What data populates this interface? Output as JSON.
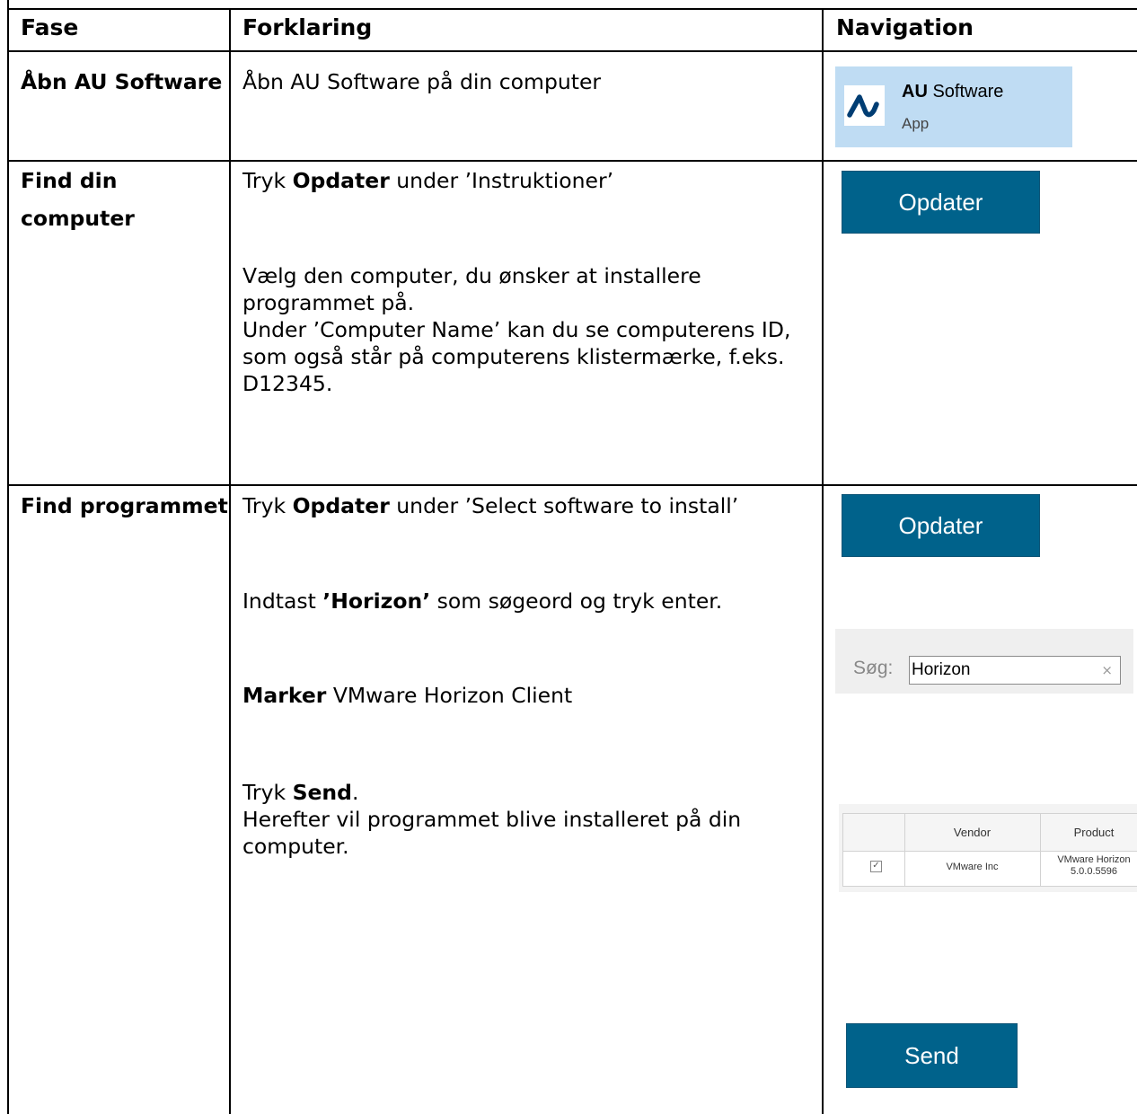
{
  "table": {
    "headers": {
      "phase": "Fase",
      "explanation": "Forklaring",
      "navigation": "Navigation"
    },
    "rows": [
      {
        "phase": "Åbn AU Software",
        "explanation": "Åbn AU Software på din computer"
      },
      {
        "phase_line1": "Find din",
        "phase_line2": "computer",
        "step1_prefix": "Tryk ",
        "step1_bold": "Opdater",
        "step1_suffix": " under ’Instruktioner’",
        "step2_line1": "Vælg den computer, du ønsker at installere",
        "step2_line2": "programmet på.",
        "step2_line3": "Under ’Computer Name’ kan du se computerens ID,",
        "step2_line4": "som også står på computerens klistermærke, f.eks.",
        "step2_line5": "D12345."
      },
      {
        "phase": "Find programmet",
        "step1_prefix": "Tryk ",
        "step1_bold": "Opdater",
        "step1_suffix": " under ’Select software to install’",
        "step2_prefix": "Indtast ",
        "step2_bold": "’Horizon’",
        "step2_suffix": " som søgeord og tryk enter.",
        "step3_bold": "Marker",
        "step3_suffix": " VMware Horizon Client",
        "step4_prefix": "Tryk ",
        "step4_bold": "Send",
        "step4_suffix": ".",
        "step5_line1": "Herefter vil programmet blive installeret på din",
        "step5_line2": "computer."
      }
    ]
  },
  "navigation": {
    "au_tile": {
      "name_bold": "AU",
      "name_rest": " Software",
      "subtitle": "App"
    },
    "update_button_label": "Opdater",
    "search": {
      "label": "Søg:",
      "value": "Horizon",
      "clear_icon": "×"
    },
    "mini_table": {
      "columns": [
        "Vendor",
        "Product"
      ],
      "row": {
        "checked": true,
        "vendor": "VMware Inc",
        "product_line1": "VMware Horizon",
        "product_line2": "5.0.0.5596"
      }
    },
    "send_button_label": "Send"
  },
  "colors": {
    "button_blue": "#00628b",
    "tile_blue": "#bfdcf3",
    "au_logo_blue": "#003d73"
  }
}
